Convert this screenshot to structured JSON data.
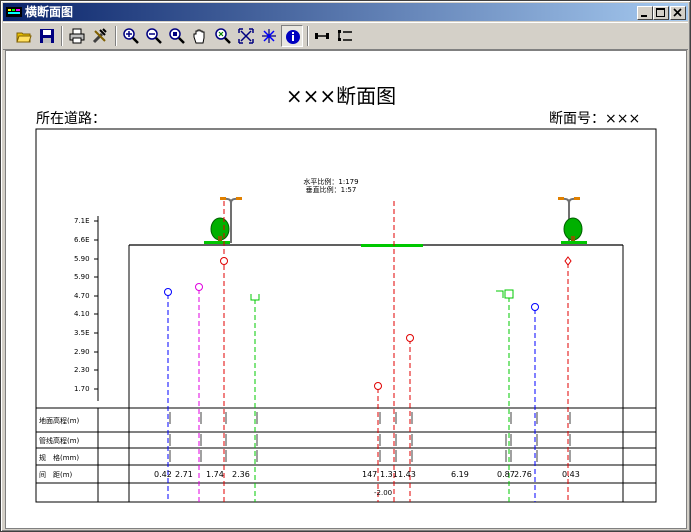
{
  "window": {
    "title": "横断面图",
    "buttons": {
      "minimize": "_",
      "maximize": "□",
      "close": "×"
    }
  },
  "toolbar": {
    "items": [
      {
        "name": "open-icon"
      },
      {
        "name": "save-icon"
      },
      {
        "name": "print-icon"
      },
      {
        "name": "settings-icon"
      },
      {
        "name": "zoom-in-icon"
      },
      {
        "name": "zoom-out-icon"
      },
      {
        "name": "zoom-window-icon"
      },
      {
        "name": "pan-hand-icon"
      },
      {
        "name": "zoom-realtime-icon"
      },
      {
        "name": "zoom-extents-icon"
      },
      {
        "name": "zoom-previous-icon"
      },
      {
        "name": "info-icon",
        "active": true
      },
      {
        "name": "line-style-icon"
      },
      {
        "name": "list-icon"
      }
    ]
  },
  "drawing": {
    "title": "×××断面图",
    "road_label": "所在道路：",
    "section_label": "断面号：×××",
    "scale_h": "水平比例：1:179",
    "scale_v": "垂直比例：1:57",
    "elevations": [
      "7.1E",
      "6.6E",
      "5.90",
      "5.90",
      "4.70",
      "4.10",
      "3.5E",
      "2.90",
      "2.30",
      "1.70"
    ],
    "row_labels": [
      "地面高程(m)",
      "管线高程(m)",
      "规　格(mm)",
      "间　距(m)"
    ],
    "bottom_value": "-2.00",
    "spacings": [
      "0.42",
      "2.71",
      "1.74",
      "2.36",
      "147",
      "1.31",
      "1.43",
      "6.19",
      "0.87",
      "2.76",
      "0.43"
    ],
    "colors": {
      "blue": "#0000ff",
      "magenta": "#e000e0",
      "red": "#e00000",
      "green": "#00c800",
      "black": "#000000"
    }
  }
}
